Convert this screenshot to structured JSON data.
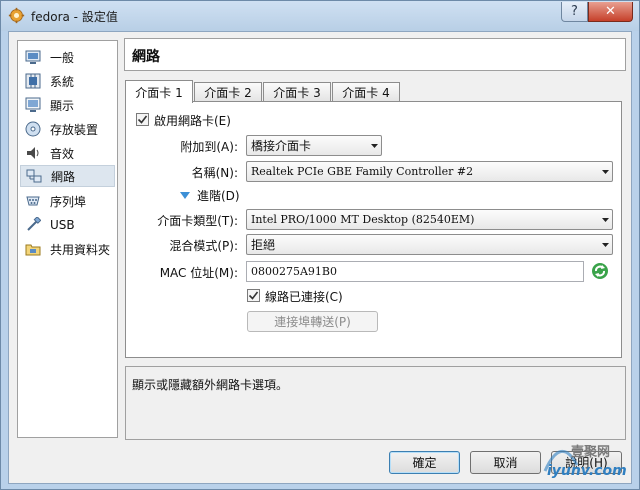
{
  "window": {
    "title": "fedora - 設定值",
    "help_glyph": "?",
    "close_glyph": "✕"
  },
  "sidebar": {
    "items": [
      {
        "label": "一般",
        "icon": "general-icon"
      },
      {
        "label": "系統",
        "icon": "system-icon"
      },
      {
        "label": "顯示",
        "icon": "display-icon"
      },
      {
        "label": "存放裝置",
        "icon": "storage-icon"
      },
      {
        "label": "音效",
        "icon": "audio-icon"
      },
      {
        "label": "網路",
        "icon": "network-icon",
        "selected": true
      },
      {
        "label": "序列埠",
        "icon": "serial-port-icon"
      },
      {
        "label": "USB",
        "icon": "usb-icon"
      },
      {
        "label": "共用資料夾",
        "icon": "shared-folder-icon"
      }
    ]
  },
  "header": {
    "title": "網路"
  },
  "tabs": [
    {
      "label": "介面卡 1",
      "active": true
    },
    {
      "label": "介面卡 2"
    },
    {
      "label": "介面卡 3"
    },
    {
      "label": "介面卡 4"
    }
  ],
  "adapter": {
    "enable_label": "啟用網路卡(E)",
    "enable_checked": true,
    "attached_label": "附加到(A):",
    "attached_value": "橋接介面卡",
    "name_label": "名稱(N):",
    "name_value": "Realtek PCIe GBE Family Controller #2",
    "advanced_label": "進階(D)",
    "type_label": "介面卡類型(T):",
    "type_value": "Intel PRO/1000 MT Desktop (82540EM)",
    "promiscuous_label": "混合模式(P):",
    "promiscuous_value": "拒絕",
    "mac_label": "MAC 位址(M):",
    "mac_value": "0800275A91B0",
    "cable_label": "線路已連接(C)",
    "cable_checked": true,
    "port_forwarding_label": "連接埠轉送(P)"
  },
  "description": "顯示或隱藏額外網路卡選項。",
  "buttons": {
    "ok": "確定",
    "cancel": "取消",
    "help": "說明(H)"
  },
  "watermark": {
    "line1": "壹聚网",
    "line2": "iyunv.com"
  },
  "colors": {
    "accent_blue": "#1c7ed6",
    "refresh_green": "#3aa34a"
  }
}
